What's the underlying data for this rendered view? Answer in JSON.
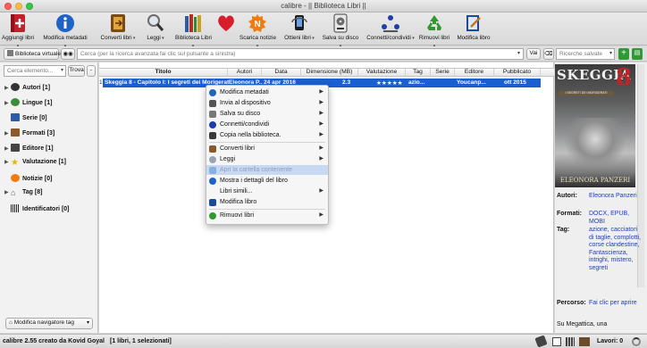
{
  "window": {
    "title": "calibre - || Biblioteca Libri ||"
  },
  "toolbar": {
    "add_books": "Aggiungi libri",
    "edit_metadata": "Modifica metadati",
    "convert_books": "Converti libri",
    "read": "Leggi",
    "library": "Biblioteca Libri",
    "fetch_news": "Scarica notizie",
    "get_books": "Ottieni libri",
    "save_to_disk": "Salva su disco",
    "connect_share": "Connetti/condividi",
    "remove_books": "Rimuovi libri",
    "edit_book": "Modifica libro"
  },
  "searchbar": {
    "virtual_library": "Biblioteca virtuale",
    "search_placeholder": "Cerca (per la ricerca avanzata fai clic sul pulsante a sinistra)",
    "go": "Vai",
    "saved_searches": "Ricerche salvate"
  },
  "tag_browser": {
    "find_placeholder": "Cerca elemento...",
    "find_button": "Trova",
    "collapse": "-",
    "items": [
      {
        "label": "Autori [1]",
        "icon": "author-icon"
      },
      {
        "label": "Lingue [1]",
        "icon": "language-icon"
      },
      {
        "label": "Serie [0]",
        "icon": "series-icon"
      },
      {
        "label": "Formati [3]",
        "icon": "formats-icon"
      },
      {
        "label": "Editore [1]",
        "icon": "publisher-icon"
      },
      {
        "label": "Valutazione [1]",
        "icon": "rating-icon"
      },
      {
        "label": "Notizie [0]",
        "icon": "news-icon"
      },
      {
        "label": "Tag [8]",
        "icon": "tag-icon"
      },
      {
        "label": "Identificatori [0]",
        "icon": "identifier-icon"
      }
    ],
    "manage_button": "Modifica navigatore tag"
  },
  "book_list": {
    "columns": [
      "Titolo",
      "Autori",
      "Data",
      "Dimensione (MB)",
      "Valutazione",
      "Tag",
      "Serie",
      "Editore",
      "Pubblicato"
    ],
    "row_number": "1",
    "row": {
      "title": "Skeggia 8 - Capitolo I: I segreti dei Morigerati",
      "authors": "Eleonora P...",
      "date": "24 apr 2016",
      "size": "2.3",
      "rating": "★★★★★",
      "tags": "azio...",
      "series": "",
      "publisher": "Youcanp...",
      "published": "ott 2015"
    }
  },
  "context_menu": {
    "items": [
      {
        "label": "Modifica metadati",
        "icon": "info-icon",
        "submenu": true
      },
      {
        "label": "Invia al dispositivo",
        "icon": "device-icon",
        "submenu": true
      },
      {
        "label": "Salva su disco",
        "icon": "save-icon",
        "submenu": true
      },
      {
        "label": "Connetti/condividi",
        "icon": "connect-icon",
        "submenu": true
      },
      {
        "label": "Copia nella biblioteca.",
        "icon": "copy-icon",
        "submenu": true
      },
      {
        "label": "Converti libri",
        "icon": "convert-icon",
        "submenu": true
      },
      {
        "label": "Leggi",
        "icon": "magnifier-icon",
        "submenu": true
      },
      {
        "label": "Apri la cartella contenente",
        "icon": "folder-icon",
        "submenu": false,
        "highlighted": true
      },
      {
        "label": "Mostra i dettagli del libro",
        "icon": "info-icon",
        "submenu": false
      },
      {
        "label": "Libri simili...",
        "icon": "",
        "submenu": true
      },
      {
        "label": "Modifica libro",
        "icon": "edit-book-icon",
        "submenu": false
      },
      {
        "label": "Rimuovi libri",
        "icon": "recycle-icon",
        "submenu": true
      }
    ]
  },
  "book_details": {
    "cover": {
      "title": "SKEGGIA",
      "number": "8",
      "subtitle": "I SEGRETI DEI MORIGERATI",
      "author": "ELEONORA PANZERI"
    },
    "authors_label": "Autori:",
    "authors": "Eleonora Panzeri",
    "formats_label": "Formati:",
    "formats": "DOCX, EPUB, MOBI",
    "tags_label": "Tag:",
    "tags": "azione, cacciatori di taglie, complotti, corse clandestine, Fantascienza, intrighi, mistero, segreti",
    "path_label": "Percorso:",
    "path": "Fai clic per aprire",
    "comments": "Su Megattica, una"
  },
  "statusbar": {
    "text": "calibre 2.55 creato da Kovid Goyal",
    "selection": "[1 libri, 1 selezionati]",
    "jobs": "Lavori: 0"
  },
  "colors": {
    "selection": "#1a5fd0",
    "link": "#1d3ec0",
    "menu_highlight": "#c7d8f3"
  }
}
